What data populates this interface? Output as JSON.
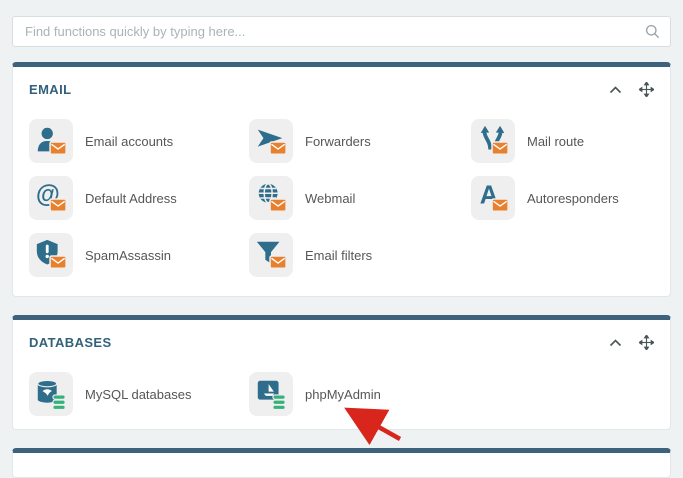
{
  "search": {
    "placeholder": "Find functions quickly by typing here...",
    "icon": "search-icon"
  },
  "colors": {
    "page_background": "#eef2f3",
    "card_top_border": "#3e627b",
    "section_title_text": "#33607b",
    "item_label_text": "#565656",
    "icon_teal": "#2f6d8c",
    "icon_orange": "#e8802d",
    "icon_green": "#35b17c",
    "arrow_red": "#d9261c"
  },
  "sections": [
    {
      "title": "EMAIL",
      "controls": {
        "collapse_icon": "chevron-up-icon",
        "move_icon": "move-icon"
      },
      "items": [
        {
          "label": "Email accounts",
          "icon": "email-accounts-icon"
        },
        {
          "label": "Forwarders",
          "icon": "forwarders-icon"
        },
        {
          "label": "Mail route",
          "icon": "mail-route-icon"
        },
        {
          "label": "Default Address",
          "icon": "default-address-icon"
        },
        {
          "label": "Webmail",
          "icon": "webmail-icon"
        },
        {
          "label": "Autoresponders",
          "icon": "autoresponders-icon"
        },
        {
          "label": "SpamAssassin",
          "icon": "spamassassin-icon"
        },
        {
          "label": "Email filters",
          "icon": "email-filters-icon"
        }
      ]
    },
    {
      "title": "DATABASES",
      "controls": {
        "collapse_icon": "chevron-up-icon",
        "move_icon": "move-icon"
      },
      "items": [
        {
          "label": "MySQL databases",
          "icon": "mysql-databases-icon"
        },
        {
          "label": "phpMyAdmin",
          "icon": "phpmyadmin-icon"
        }
      ]
    }
  ],
  "annotation": {
    "type": "red-arrow",
    "points_to": "phpMyAdmin"
  }
}
